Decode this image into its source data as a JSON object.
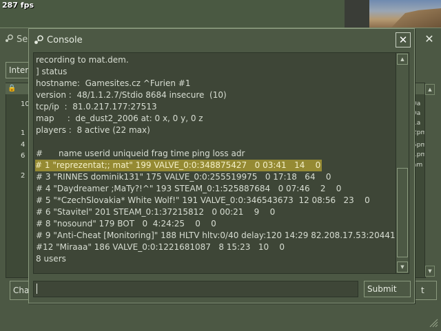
{
  "hud": {
    "fps": "287 fps"
  },
  "background_window": {
    "title": "Se",
    "tab_label": "Inter",
    "rows_left": [
      "10",
      "1",
      "4",
      "6",
      "2"
    ],
    "rows_right": [
      "0a",
      "9a",
      "1a",
      "2pm",
      "5pm",
      "1pm",
      "1pm",
      "am"
    ],
    "chat_button": "Cha",
    "right_button": "t"
  },
  "console": {
    "title": "Console",
    "submit_label": "Submit",
    "input_value": "",
    "lines": [
      {
        "text": "recording to mat.dem.",
        "selected": false
      },
      {
        "text": "] status",
        "selected": false
      },
      {
        "text": "hostname:  Gamesites.cz ^Furien #1",
        "selected": false
      },
      {
        "text": "version :  48/1.1.2.7/Stdio 8684 insecure  (10)",
        "selected": false
      },
      {
        "text": "tcp/ip  :  81.0.217.177:27513",
        "selected": false
      },
      {
        "text": "map     :  de_dust2_2006 at: 0 x, 0 y, 0 z",
        "selected": false
      },
      {
        "text": "players :  8 active (22 max)",
        "selected": false
      },
      {
        "text": "",
        "selected": false
      },
      {
        "text": "#      name userid uniqueid frag time ping loss adr",
        "selected": false
      },
      {
        "text": "# 1 \"reprezentat;; mat\" 199 VALVE_0:0:348875427   0 03:41   14    0",
        "selected": true
      },
      {
        "text": "# 3 \"RINNES dominik131\" 175 VALVE_0:0:255519975   0 17:18   64    0",
        "selected": false
      },
      {
        "text": "# 4 \"Daydreamer ;MaTy?!^\" 193 STEAM_0:1:525887684   0 07:46    2    0",
        "selected": false
      },
      {
        "text": "# 5 \"*CzechSlovakia* White Wolf!\" 191 VALVE_0:0:346543673  12 08:56   23    0",
        "selected": false
      },
      {
        "text": "# 6 \"Stavitel\" 201 STEAM_0:1:37215812   0 00:21    9    0",
        "selected": false
      },
      {
        "text": "# 8 \"nosound\" 179 BOT   0  4:24:25    0    0",
        "selected": false
      },
      {
        "text": "# 9 \"Anti-Cheat [Monitoring]\" 188 HLTV hltv:0/40 delay:120 14:29 82.208.17.53:20441",
        "selected": false
      },
      {
        "text": "#12 \"Miraaa\" 186 VALVE_0:0:1221681087   8 15:23   10    0",
        "selected": false
      },
      {
        "text": "8 users",
        "selected": false
      }
    ]
  },
  "colors": {
    "window_bg": "#4c5844",
    "output_bg": "#3e4637",
    "selection": "#958a33",
    "text": "#d8ded3"
  }
}
